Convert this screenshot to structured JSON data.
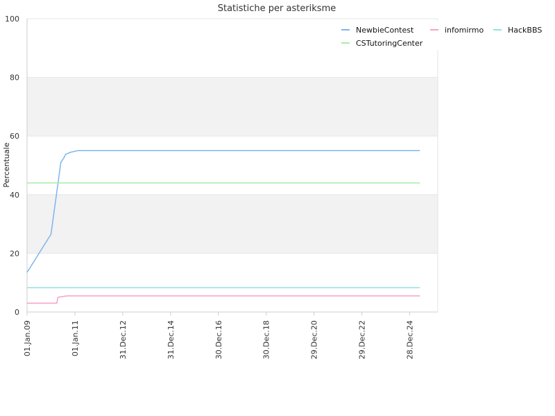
{
  "chart_data": {
    "type": "line",
    "title": "Statistiche per asteriksme",
    "xlabel": "",
    "ylabel": "Percentuale",
    "ylim": [
      0,
      100
    ],
    "yticks": [
      0,
      20,
      40,
      60,
      80,
      100
    ],
    "xlim": [
      "2009-01-01",
      "2026-03-01"
    ],
    "xticks": [
      {
        "label": "01.Jan.09",
        "date": "2009-01-01"
      },
      {
        "label": "01.Jan.11",
        "date": "2011-01-01"
      },
      {
        "label": "31.Dec.12",
        "date": "2012-12-31"
      },
      {
        "label": "31.Dec.14",
        "date": "2014-12-31"
      },
      {
        "label": "30.Dec.16",
        "date": "2016-12-30"
      },
      {
        "label": "30.Dec.18",
        "date": "2018-12-30"
      },
      {
        "label": "29.Dec.20",
        "date": "2020-12-29"
      },
      {
        "label": "29.Dec.22",
        "date": "2022-12-29"
      },
      {
        "label": "28.Dec.24",
        "date": "2024-12-28"
      }
    ],
    "grid": "alternating horizontal bands",
    "band_color": "#f2f2f2",
    "legend_position": "top-right",
    "series": [
      {
        "name": "NewbieContest",
        "color": "#7cb5ec",
        "points": [
          [
            "2009-01-01",
            13.5
          ],
          [
            "2010-01-01",
            26.5
          ],
          [
            "2010-06-01",
            51
          ],
          [
            "2010-07-15",
            52.5
          ],
          [
            "2010-08-15",
            53.8
          ],
          [
            "2010-11-01",
            54.5
          ],
          [
            "2011-02-15",
            55
          ],
          [
            "2025-06-01",
            55
          ]
        ]
      },
      {
        "name": "infomirmo",
        "color": "#f7a1c4",
        "points": [
          [
            "2009-01-01",
            3
          ],
          [
            "2010-04-01",
            3
          ],
          [
            "2010-04-15",
            5
          ],
          [
            "2010-07-01",
            5.3
          ],
          [
            "2010-09-01",
            5.5
          ],
          [
            "2025-06-01",
            5.5
          ]
        ]
      },
      {
        "name": "HackBBS",
        "color": "#8ee3e3",
        "points": [
          [
            "2009-01-01",
            8.3
          ],
          [
            "2025-06-01",
            8.3
          ]
        ]
      },
      {
        "name": "CSTutoringCenter",
        "color": "#a8eca8",
        "points": [
          [
            "2009-01-01",
            44
          ],
          [
            "2025-06-01",
            44
          ]
        ]
      }
    ]
  }
}
